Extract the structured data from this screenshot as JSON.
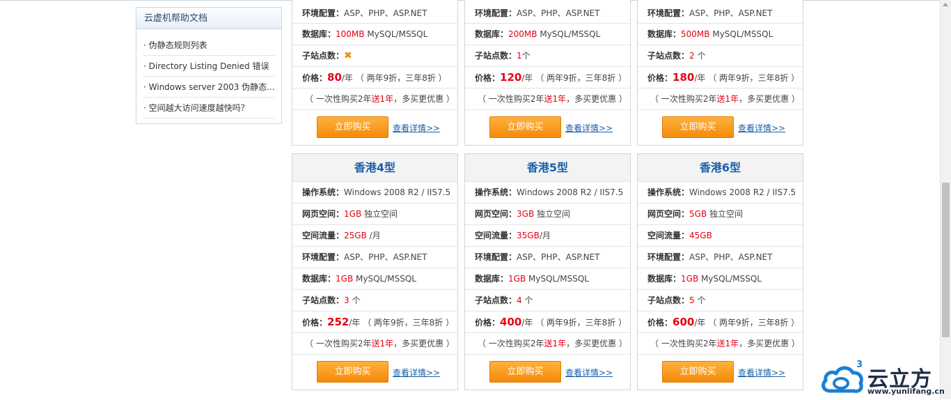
{
  "sidebar": {
    "title": "云虚机帮助文档",
    "items": [
      "· 伪静态规则列表",
      "· Directory Listing Denied 错误",
      "· Windows server 2003 伪静态...",
      "· 空间越大访问速度越快吗？"
    ]
  },
  "labels": {
    "os": "操作系统：",
    "space": "网页空间：",
    "traffic": "空间流量：",
    "env": "环境配置：",
    "db": "数据库：",
    "sites": "子站点数：",
    "price": "价格：",
    "per_year": "/年",
    "discount": "（ 两年9折，三年8折 ）",
    "promo_pre": "（ 一次性购买2年",
    "promo_red": "送1年",
    "promo_post": "，多买更优惠 ）",
    "buy": "立即购买",
    "detail": "查看详情>>"
  },
  "top_cards": [
    {
      "env": "ASP、PHP、ASP.NET",
      "db_size": "100MB",
      "db_type": "MySQL/MSSQL",
      "sites_value": "",
      "sites_unit": "",
      "no_sites": true,
      "price": "80"
    },
    {
      "env": "ASP、PHP、ASP.NET",
      "db_size": "200MB",
      "db_type": "MySQL/MSSQL",
      "sites_value": "1",
      "sites_unit": "个",
      "no_sites": false,
      "price": "120"
    },
    {
      "env": "ASP、PHP、ASP.NET",
      "db_size": "500MB",
      "db_type": "MySQL/MSSQL",
      "sites_value": "2",
      "sites_unit": " 个",
      "no_sites": false,
      "price": "180"
    }
  ],
  "bottom_cards": [
    {
      "title": "香港4型",
      "os": "Windows 2008 R2 / IIS7.5",
      "space_value": "1GB",
      "space_unit": " 独立空间",
      "traffic_value": "25GB",
      "traffic_unit": " /月",
      "env": "ASP、PHP、ASP.NET",
      "db_size": "1GB",
      "db_type": " MySQL/MSSQL",
      "sites_value": "3",
      "sites_unit": " 个",
      "price": "252"
    },
    {
      "title": "香港5型",
      "os": "Windows 2008 R2 / IIS7.5",
      "space_value": "3GB",
      "space_unit": " 独立空间",
      "traffic_value": "35GB",
      "traffic_unit": "/月",
      "env": "ASP、PHP、ASP.NET",
      "db_size": "1GB",
      "db_type": " MySQL/MSSQL",
      "sites_value": "4",
      "sites_unit": " 个",
      "price": "400"
    },
    {
      "title": "香港6型",
      "os": "Windows 2008 R2 / IIS7.5",
      "space_value": "5GB",
      "space_unit": " 独立空间",
      "traffic_value": "45GB",
      "traffic_unit": "",
      "env": "ASP、PHP、ASP.NET",
      "db_size": "1GB",
      "db_type": " MySQL/MSSQL",
      "sites_value": "5",
      "sites_unit": " 个",
      "price": "600"
    }
  ],
  "logo": {
    "text": "云立方",
    "url": "www.yunlifang.cn",
    "badge": "3"
  },
  "colors": {
    "accent_red": "#e60012",
    "title_blue": "#1a5fa8",
    "button_orange": "#f58a0a"
  }
}
